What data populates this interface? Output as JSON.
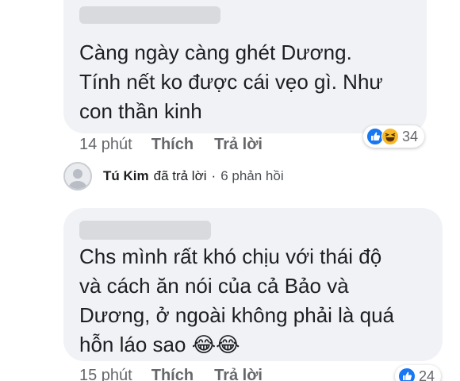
{
  "comments": [
    {
      "lines": [
        "Càng ngày càng ghét Dương.",
        "Tính nết ko được cái vẹo gì. Như",
        "con thần kinh"
      ],
      "time": "14 phút",
      "like_label": "Thích",
      "reply_label": "Trả lời",
      "reactions": {
        "icons": [
          "like-icon",
          "laugh-icon"
        ],
        "count": "34"
      }
    },
    {
      "lines": [
        "Chs mình rất khó chịu với thái độ",
        "và cách ăn nói của cả Bảo và",
        "Dương, ở ngoài không phải là quá",
        "hỗn láo sao"
      ],
      "emojis": [
        "😂",
        "😂"
      ],
      "time": "15 phút",
      "like_label": "Thích",
      "reply_label": "Trả lời",
      "reactions": {
        "icons": [
          "like-icon"
        ],
        "count": "24"
      }
    }
  ],
  "reply_summary": {
    "author": "Tú Kim",
    "text": "đã trả lời",
    "separator": "·",
    "count_text": "6 phản hồi"
  },
  "colors": {
    "bubble": "#f0f2f5",
    "secondary_text": "#65676b",
    "like_blue": "#1877f2",
    "laugh_yellow": "#f7b928"
  }
}
